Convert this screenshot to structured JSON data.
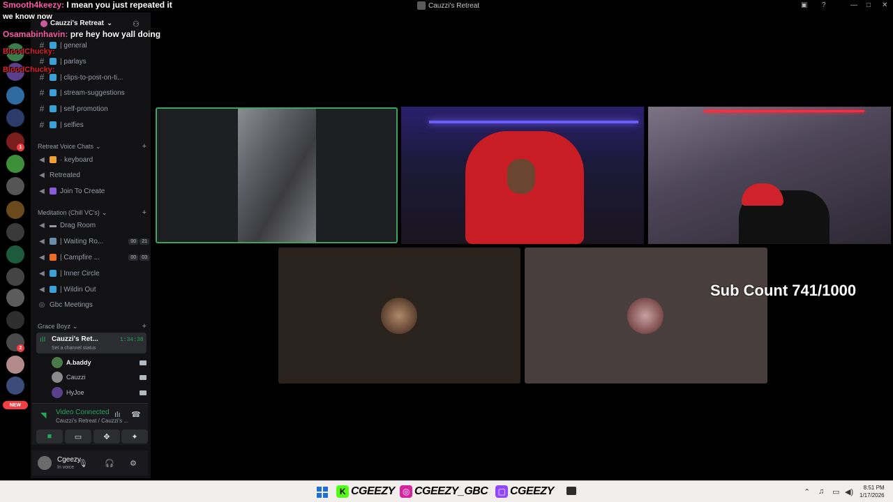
{
  "window": {
    "title": "Cauzzi's Retreat"
  },
  "server": {
    "name": "Cauzzi's Retreat"
  },
  "text_channels": [
    {
      "name": "| general"
    },
    {
      "name": "| parlays"
    },
    {
      "name": "| clips-to-post-on-ti..."
    },
    {
      "name": "| stream-suggestions"
    },
    {
      "name": "| self-promotion"
    },
    {
      "name": "| selfies"
    }
  ],
  "categories": {
    "retreat_voice": "Retreat Voice Chats",
    "meditation": "Meditation (Chill VC's)",
    "grace_boyz": "Grace Boyz"
  },
  "retreat_voice_channels": [
    {
      "name": "· keyboard"
    },
    {
      "name": "Retreated"
    },
    {
      "name": "Join To Create"
    }
  ],
  "meditation_channels": [
    {
      "name": "Drag Room"
    },
    {
      "name": "| Waiting Ro...",
      "count_a": "00",
      "count_b": "21"
    },
    {
      "name": "| Campfire ...",
      "count_a": "00",
      "count_b": "03"
    },
    {
      "name": "| Inner Circle"
    },
    {
      "name": "| Wildin Out"
    },
    {
      "name": "Gbc Meetings"
    }
  ],
  "active_voice": {
    "name": "Cauzzi's Ret...",
    "timer": "1:34:38",
    "status_placeholder": "Set a channel status"
  },
  "members": [
    {
      "name": "A.baddy"
    },
    {
      "name": "Cauzzi"
    },
    {
      "name": "HyJoe"
    }
  ],
  "voice_panel": {
    "state": "Video Connected",
    "location": "Cauzzi's Retreat / Cauzzi's ..."
  },
  "user": {
    "name": "Cgeezy",
    "status": "In voice"
  },
  "rail": {
    "new_badge": "NEW",
    "badge_a": "1",
    "badge_b": "2"
  },
  "overlay": {
    "sub_count": "Sub Count 741/1000"
  },
  "chat": [
    {
      "user": "Smooth4keezy:",
      "message": "I mean you just repeated it"
    },
    {
      "user": "",
      "message": "we know now"
    },
    {
      "user": "Osamabinhavin:",
      "message": "pre hey how yall doing"
    },
    {
      "user": "BloodChucky:",
      "message": ""
    },
    {
      "user": "BloodChucky:",
      "message": ""
    }
  ],
  "taskbar": {
    "kick": "CGEEZY",
    "instagram": "CGEEZY_GBC",
    "twitch": "CGEEZY",
    "time": "8:51 PM",
    "date": "1/17/2026"
  },
  "colors": {
    "accent_green": "#23a55a",
    "speaking_border": "#3ba55d",
    "danger": "#f23f43"
  }
}
